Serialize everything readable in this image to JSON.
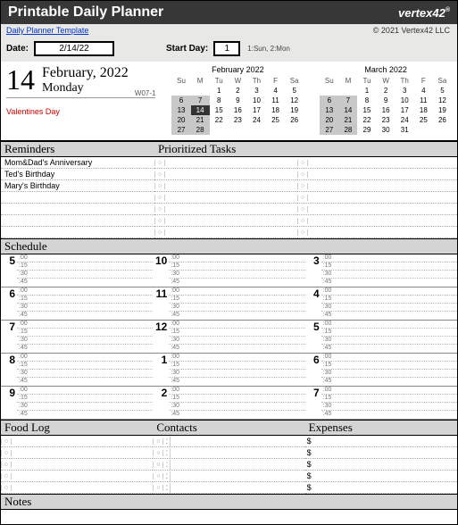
{
  "header": {
    "title": "Printable Daily Planner",
    "brand": "vertex42",
    "link": "Daily Planner Template",
    "copyright": "© 2021 Vertex42 LLC",
    "date_label": "Date:",
    "date_value": "2/14/22",
    "start_label": "Start Day:",
    "start_value": "1",
    "start_hint": "1:Sun, 2:Mon"
  },
  "day": {
    "num": "14",
    "month_year": "February, 2022",
    "weekday": "Monday",
    "special": "Valentines Day",
    "week": "W07-1"
  },
  "cal1": {
    "title": "February 2022",
    "dow": [
      "Su",
      "M",
      "Tu",
      "W",
      "Th",
      "F",
      "Sa"
    ],
    "rows": [
      [
        "",
        "",
        "1",
        "2",
        "3",
        "4",
        "5"
      ],
      [
        "6",
        "7",
        "8",
        "9",
        "10",
        "11",
        "12"
      ],
      [
        "13",
        "14",
        "15",
        "16",
        "17",
        "18",
        "19"
      ],
      [
        "20",
        "21",
        "22",
        "23",
        "24",
        "25",
        "26"
      ],
      [
        "27",
        "28",
        "",
        "",
        "",
        "",
        ""
      ]
    ],
    "hl_today": "14"
  },
  "cal2": {
    "title": "March 2022",
    "dow": [
      "Su",
      "M",
      "Tu",
      "W",
      "Th",
      "F",
      "Sa"
    ],
    "rows": [
      [
        "",
        "",
        "1",
        "2",
        "3",
        "4",
        "5"
      ],
      [
        "6",
        "7",
        "8",
        "9",
        "10",
        "11",
        "12"
      ],
      [
        "13",
        "14",
        "15",
        "16",
        "17",
        "18",
        "19"
      ],
      [
        "20",
        "21",
        "22",
        "23",
        "24",
        "25",
        "26"
      ],
      [
        "27",
        "28",
        "29",
        "30",
        "31",
        "",
        ""
      ]
    ]
  },
  "sections": {
    "reminders": "Reminders",
    "tasks": "Prioritized Tasks",
    "schedule": "Schedule",
    "food": "Food Log",
    "contacts": "Contacts",
    "expenses": "Expenses",
    "notes": "Notes"
  },
  "reminders": [
    "Mom&Dad's Anniversary",
    "Ted's Birthday",
    "Mary's Birthday",
    "",
    "",
    "",
    ""
  ],
  "tasks_rows": 7,
  "schedule": {
    "cols": [
      [
        "5",
        "6",
        "7",
        "8",
        "9"
      ],
      [
        "10",
        "11",
        "12",
        "1",
        "2"
      ],
      [
        "3",
        "4",
        "5",
        "6",
        "7"
      ]
    ],
    "mins": [
      ":00",
      ":15",
      ":30",
      ":45"
    ]
  },
  "food_rows": 5,
  "expense_prefix": "$"
}
